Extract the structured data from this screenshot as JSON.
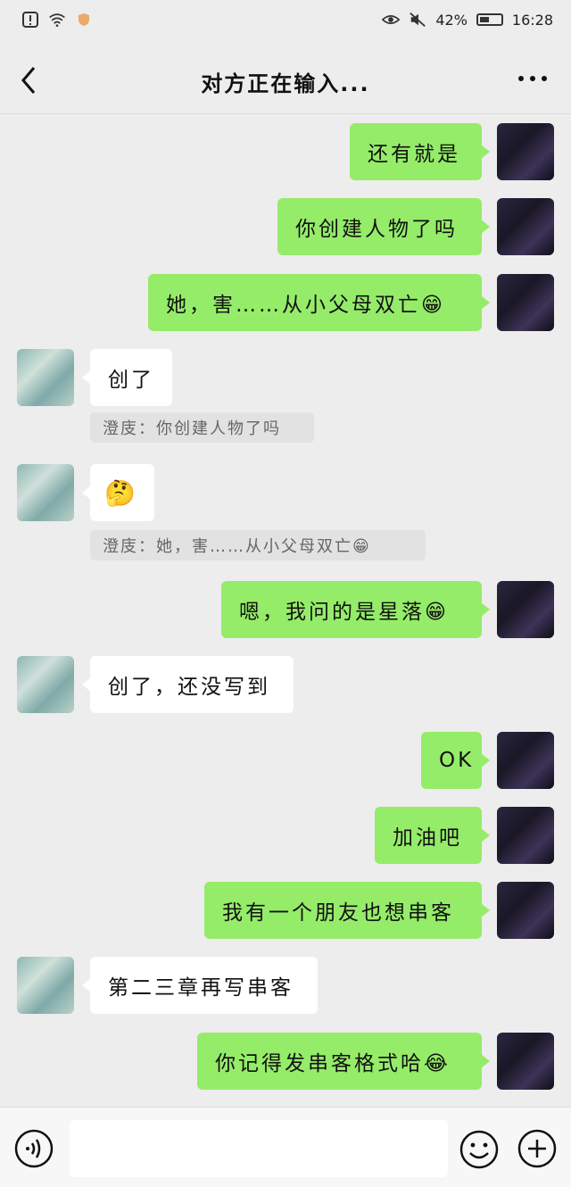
{
  "status_bar": {
    "battery": "42%",
    "time": "16:28"
  },
  "header": {
    "title": "对方正在输入..."
  },
  "messages": [
    {
      "text": "还有就是"
    },
    {
      "text": "你创建人物了吗"
    },
    {
      "text": "她，害……从小父母双亡😁"
    },
    {
      "text": "创了",
      "quote": "澄庋：你创建人物了吗"
    },
    {
      "text": "🤔",
      "quote": "澄庋：她，害……从小父母双亡😁"
    },
    {
      "text": "嗯，我问的是星落😁"
    },
    {
      "text": "创了，还没写到"
    },
    {
      "text": "OK"
    },
    {
      "text": "加油吧"
    },
    {
      "text": "我有一个朋友也想串客"
    },
    {
      "text": "第二三章再写串客"
    },
    {
      "text": "你记得发串客格式哈😂"
    }
  ],
  "input": {
    "placeholder": ""
  },
  "colors": {
    "my_bubble": "#95ec69",
    "their_bubble": "#ffffff",
    "background": "#ededed"
  }
}
